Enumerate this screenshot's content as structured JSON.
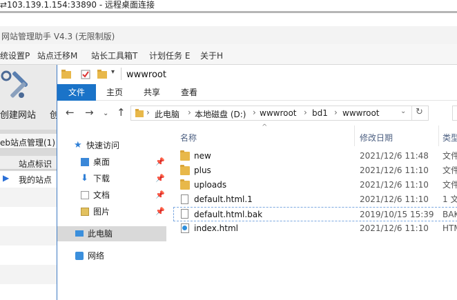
{
  "rdp": {
    "title": "103.139.1.154:33890 - 远程桌面连接",
    "icon": "remote-desktop-icon"
  },
  "bgapp": {
    "title": "网站管理助手 V4.3 (无限制版)",
    "menu": [
      "统设置P",
      "站点迁移M",
      "站长工具箱T",
      "计划任务 E",
      "关于H"
    ],
    "tool_label": "创建网站",
    "tool_label2": "创",
    "panel_title": "eb站点管理(1)",
    "grid_header": "站点标识",
    "row_label": "我的站点"
  },
  "explorer": {
    "title": "wwwroot",
    "ribbon_tabs": [
      "文件",
      "主页",
      "共享",
      "查看"
    ],
    "breadcrumb": [
      "此电脑",
      "本地磁盘 (D:)",
      "wwwroot",
      "bd1",
      "wwwroot"
    ],
    "nav": {
      "quick_access": "快速访问",
      "desktop": "桌面",
      "downloads": "下载",
      "documents": "文档",
      "pictures": "图片",
      "this_pc": "此电脑",
      "network": "网络"
    },
    "columns": {
      "name": "名称",
      "date": "修改日期",
      "type": "类型"
    },
    "files": [
      {
        "name": "new",
        "date": "2021/12/6 11:48",
        "type": "文件",
        "kind": "folder"
      },
      {
        "name": "plus",
        "date": "2021/12/6 11:10",
        "type": "文件",
        "kind": "folder"
      },
      {
        "name": "uploads",
        "date": "2021/12/6 11:10",
        "type": "文件",
        "kind": "folder"
      },
      {
        "name": "default.html.1",
        "date": "2021/12/6 11:10",
        "type": "1 文",
        "kind": "file"
      },
      {
        "name": "default.html.bak",
        "date": "2019/10/15 15:39",
        "type": "BAK",
        "kind": "file"
      },
      {
        "name": "index.html",
        "date": "2021/12/6 11:10",
        "type": "HTM",
        "kind": "html"
      }
    ]
  },
  "colors": {
    "accent": "#1a73c8",
    "folder": "#e8b84a",
    "header_text": "#4d6082"
  }
}
